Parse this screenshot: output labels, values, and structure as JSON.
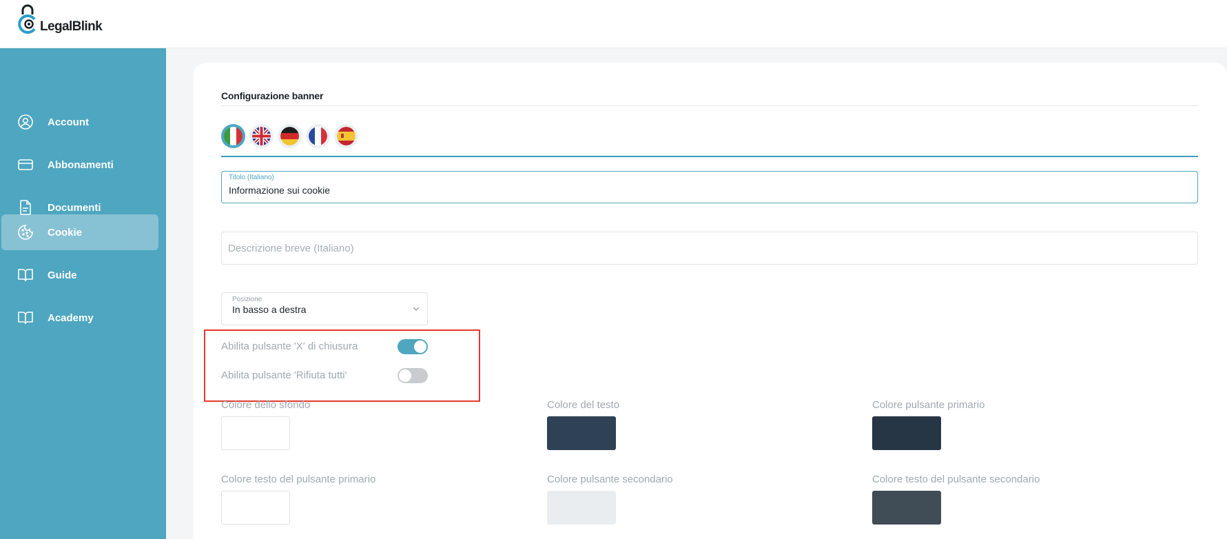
{
  "brand": {
    "name": "LegalBlink"
  },
  "sidebar": {
    "items": [
      {
        "label": "Account",
        "icon": "user-circle-icon",
        "active": false
      },
      {
        "label": "Abbonamenti",
        "icon": "credit-card-icon",
        "active": false
      },
      {
        "label": "Documenti",
        "icon": "document-icon",
        "active": false
      },
      {
        "label": "Cookie",
        "icon": "cookie-icon",
        "active": true
      },
      {
        "label": "Guide",
        "icon": "book-icon",
        "active": false
      },
      {
        "label": "Academy",
        "icon": "book-icon",
        "active": false
      }
    ]
  },
  "main": {
    "section_title": "Configurazione banner",
    "languages": [
      {
        "icon": "flag-italy-icon",
        "active": true
      },
      {
        "icon": "flag-uk-icon",
        "active": false
      },
      {
        "icon": "flag-germany-icon",
        "active": false
      },
      {
        "icon": "flag-france-icon",
        "active": false
      },
      {
        "icon": "flag-spain-icon",
        "active": false
      }
    ],
    "title_field": {
      "label": "Titolo (Italiano)",
      "value": "Informazione sui cookie"
    },
    "description_field": {
      "placeholder": "Descrizione breve (Italiano)",
      "value": ""
    },
    "position_select": {
      "label": "Posizione",
      "value": "In basso a destra"
    },
    "toggles": [
      {
        "label": "Abilita pulsante 'X' di chiusura",
        "on": true
      },
      {
        "label": "Abilita pulsante 'Rifiuta tutti'",
        "on": false
      }
    ],
    "colors": [
      {
        "label": "Colore dello sfondo",
        "value": "#ffffff"
      },
      {
        "label": "Colore del testo",
        "value": "#2e4155"
      },
      {
        "label": "Colore pulsante primario",
        "value": "#263645"
      },
      {
        "label": "Colore testo del pulsante primario",
        "value": "#ffffff"
      },
      {
        "label": "Colore pulsante secondario",
        "value": "#e9edf0"
      },
      {
        "label": "Colore testo del pulsante secondario",
        "value": "#404c56"
      }
    ]
  },
  "theme": {
    "accent": "#4ea6c0",
    "highlight": "#e33a30"
  }
}
